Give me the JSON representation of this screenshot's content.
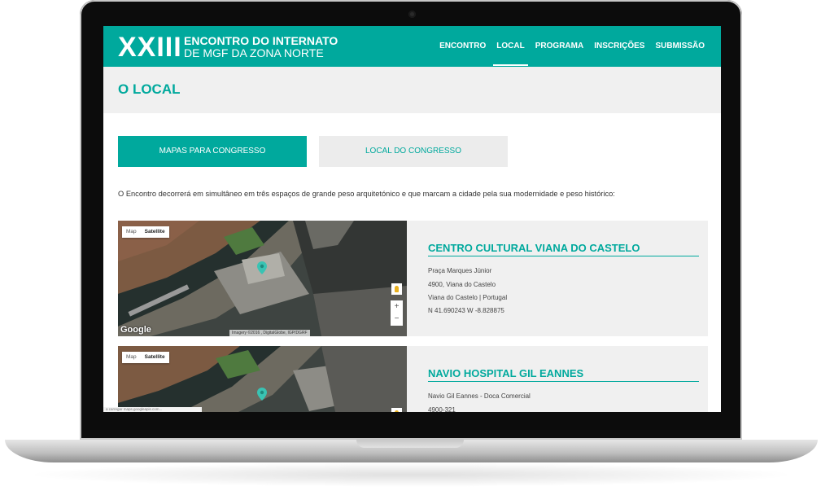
{
  "header": {
    "logo_number": "XXIII",
    "logo_line1": "ENCONTRO DO INTERNATO",
    "logo_line2": "DE MGF DA ZONA NORTE",
    "nav": [
      {
        "label": "ENCONTRO",
        "active": false
      },
      {
        "label": "LOCAL",
        "active": true
      },
      {
        "label": "PROGRAMA",
        "active": false
      },
      {
        "label": "INSCRIÇÕES",
        "active": false
      },
      {
        "label": "SUBMISSÃO",
        "active": false
      }
    ]
  },
  "page": {
    "title": "O LOCAL",
    "tabs": [
      {
        "label": "MAPAS PARA CONGRESSO",
        "selected": true
      },
      {
        "label": "LOCAL DO CONGRESSO",
        "selected": false
      }
    ],
    "intro": "O Encontro decorrerá em simultâneo em três espaços de grande peso arquitetónico e que marcam a cidade pela sua modernidade e peso histórico:"
  },
  "map_ui": {
    "map_label": "Map",
    "satellite_label": "Satellite",
    "zoom_in": "+",
    "zoom_out": "−",
    "google_label": "Google",
    "attribution": "Imagery ©2016 , DigitalGlobe, IGP/DGRF"
  },
  "venues": [
    {
      "name": "CENTRO CULTURAL VIANA DO CASTELO",
      "lines": [
        "Praça Marques Júnior",
        "4900, Viana do Castelo",
        "Viana do Castelo | Portugal",
        "N 41.690243 W -8.828875"
      ]
    },
    {
      "name": "NAVIO HOSPITAL GIL EANNES",
      "lines": [
        "Navio Gil Eannes - Doca Comercial",
        "4900-321"
      ]
    }
  ],
  "status_bar": "a carregar maps.googleapis.com...",
  "colors": {
    "accent": "#00a99d",
    "band": "#f0f0f0"
  }
}
